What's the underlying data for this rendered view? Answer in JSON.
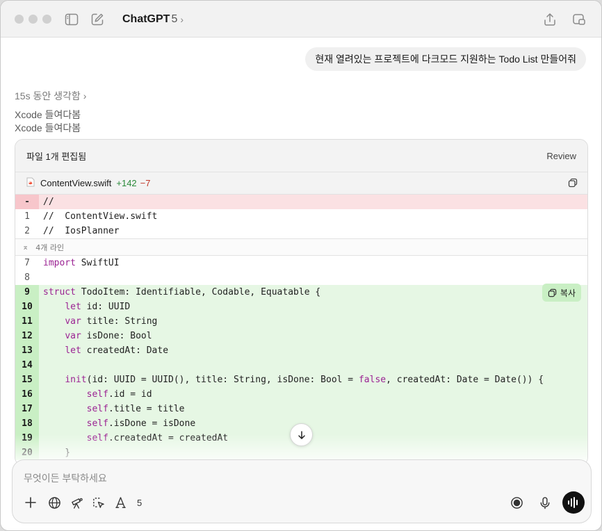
{
  "window": {
    "title": "ChatGPT",
    "model_version": "5"
  },
  "chat": {
    "user_message": "현재 열려있는 프로젝트에 다크모드 지원하는 Todo List 만들어줘",
    "thinking_label": "15s 동안 생각함",
    "actions": [
      "Xcode 들여다봄",
      "Xcode 들여다봄"
    ]
  },
  "diff_card": {
    "header_title": "파일 1개 편집됨",
    "review_label": "Review",
    "file_name": "ContentView.swift",
    "additions": "+142",
    "deletions": "−7",
    "removed_marker": "-",
    "removed_line": "//",
    "context_lines": [
      {
        "num": "1",
        "text": "//  ContentView.swift"
      },
      {
        "num": "2",
        "text": "//  IosPlanner"
      }
    ],
    "collapsed_label": "4개 라인",
    "line7": {
      "num": "7",
      "kw": "import",
      "rest": " SwiftUI"
    },
    "line8": {
      "num": "8"
    },
    "copy_label": "복사",
    "added_lines": [
      {
        "num": "9"
      },
      {
        "num": "10"
      },
      {
        "num": "11"
      },
      {
        "num": "12"
      },
      {
        "num": "13"
      },
      {
        "num": "14"
      },
      {
        "num": "15"
      },
      {
        "num": "16"
      },
      {
        "num": "17"
      },
      {
        "num": "18"
      },
      {
        "num": "19"
      },
      {
        "num": "20"
      }
    ]
  },
  "composer": {
    "placeholder": "무엇이든 부탁하세요",
    "tool_count": "5"
  }
}
